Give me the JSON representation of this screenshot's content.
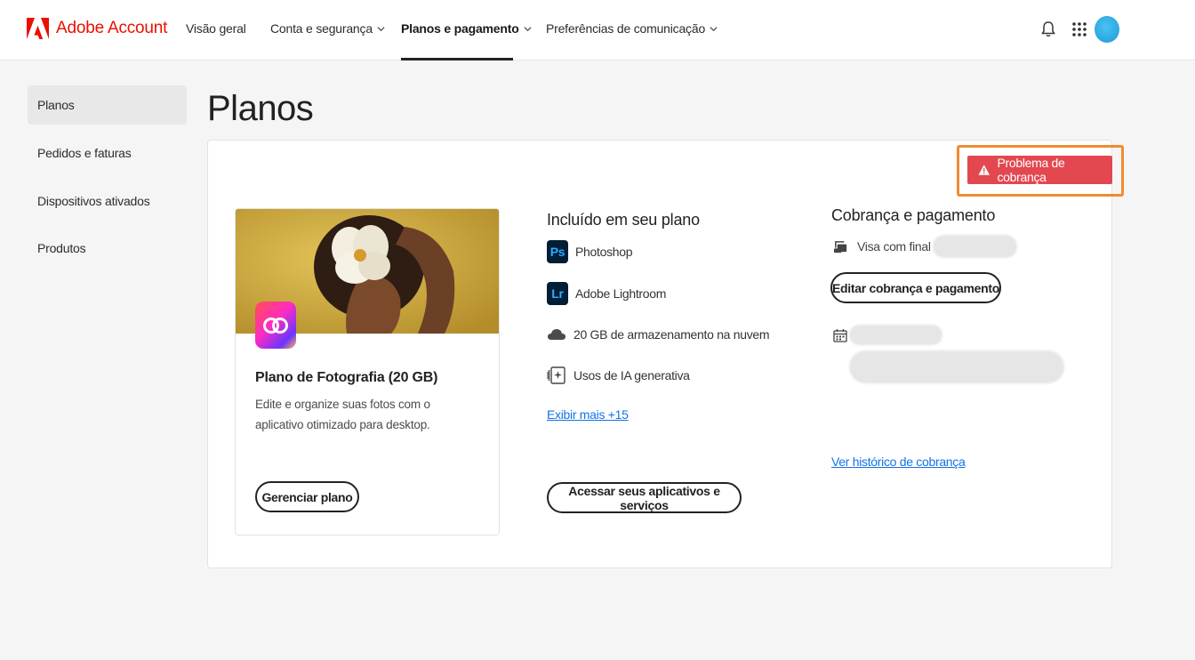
{
  "brand": {
    "name": "Adobe Account",
    "color": "#eb1000"
  },
  "nav": {
    "items": [
      {
        "label": "Visão geral",
        "has_dropdown": false
      },
      {
        "label": "Conta e segurança",
        "has_dropdown": true
      },
      {
        "label": "Planos e pagamento",
        "has_dropdown": true,
        "active": true
      },
      {
        "label": "Preferências de comunicação",
        "has_dropdown": true
      }
    ],
    "icons": [
      "bell-icon",
      "app-grid-icon",
      "avatar"
    ]
  },
  "sidebar": {
    "items": [
      {
        "label": "Planos",
        "active": true
      },
      {
        "label": "Pedidos e faturas"
      },
      {
        "label": "Dispositivos ativados"
      },
      {
        "label": "Produtos"
      }
    ]
  },
  "page": {
    "title": "Planos"
  },
  "alert": {
    "label": "Problema de cobrança",
    "color": "#e34850",
    "highlight_color": "#f28b31"
  },
  "plan": {
    "title": "Plano de Fotografia (20 GB)",
    "description": "Edite e organize suas fotos com o aplicativo otimizado para desktop.",
    "manage_button": "Gerenciar plano"
  },
  "included": {
    "heading": "Incluído em seu plano",
    "apps": [
      {
        "abbr": "Ps",
        "label": "Photoshop"
      },
      {
        "abbr": "Lr",
        "label": "Adobe Lightroom"
      }
    ],
    "features": [
      {
        "icon": "cloud-icon",
        "label": "20 GB de armazenamento na nuvem"
      },
      {
        "icon": "generative-ai-icon",
        "label": "Usos de IA generativa"
      }
    ],
    "show_more": "Exibir mais +15",
    "access_button": "Acessar seus aplicativos e serviços"
  },
  "billing": {
    "heading": "Cobrança e pagamento",
    "card_label": "Visa com final",
    "edit_button": "Editar cobrança e pagamento",
    "history_link": "Ver histórico de cobrança"
  },
  "colors": {
    "link": "#1473e6",
    "text": "#222222"
  }
}
